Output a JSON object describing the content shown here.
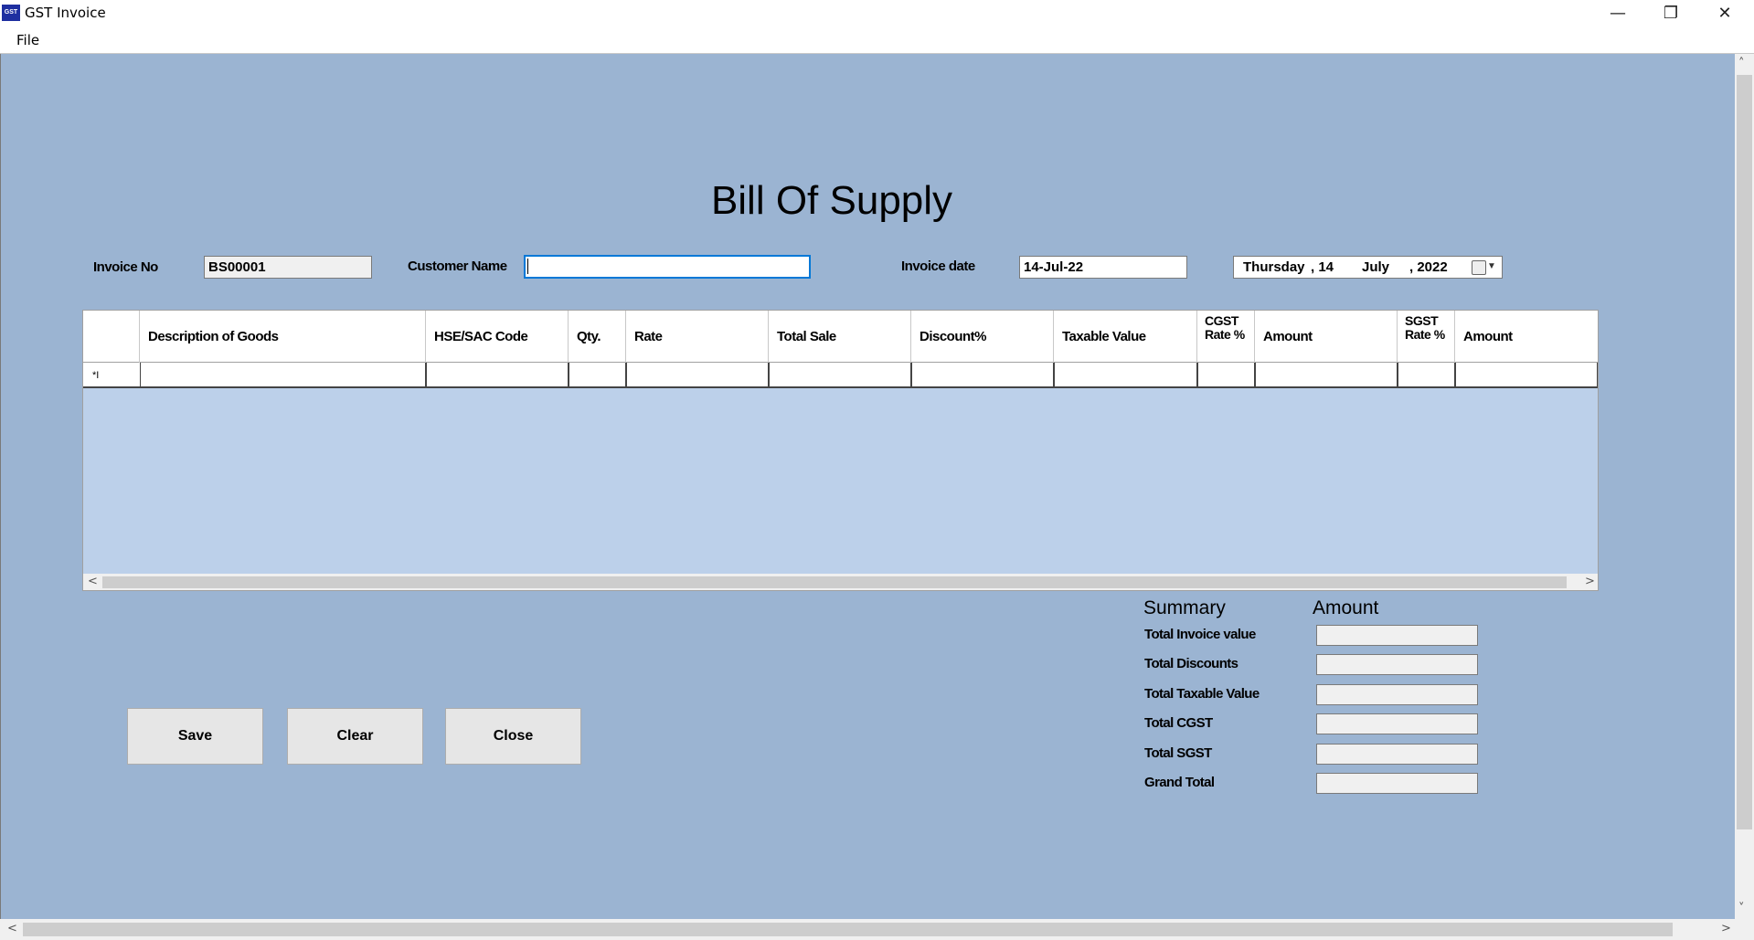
{
  "window": {
    "title": "GST Invoice",
    "icon_text": "GST",
    "minimize": "—",
    "restore": "❐",
    "close": "✕"
  },
  "menu": {
    "file": "File"
  },
  "page": {
    "heading": "Bill Of Supply"
  },
  "form": {
    "invoice_no_label": "Invoice No",
    "invoice_no_value": "BS00001",
    "customer_name_label": "Customer Name",
    "customer_name_value": "",
    "invoice_date_label": "Invoice date",
    "invoice_date_value": "14-Jul-22",
    "date_picker": {
      "weekday": "Thursday",
      "day": ", 14",
      "month": "July",
      "year": ", 2022"
    }
  },
  "grid": {
    "columns": [
      "Description of Goods",
      "HSE/SAC Code",
      "Qty.",
      "Rate",
      "Total Sale",
      "Discount%",
      "Taxable Value",
      "CGST Rate %",
      "Amount",
      "SGST Rate %",
      "Amount"
    ],
    "row_marker": "*I"
  },
  "buttons": {
    "save": "Save",
    "clear": "Clear",
    "close": "Close"
  },
  "summary": {
    "title": "Summary",
    "amount_title": "Amount",
    "rows": [
      "Total Invoice value",
      "Total Discounts",
      "Total Taxable Value",
      "Total CGST",
      "Total SGST",
      "Grand Total"
    ]
  }
}
